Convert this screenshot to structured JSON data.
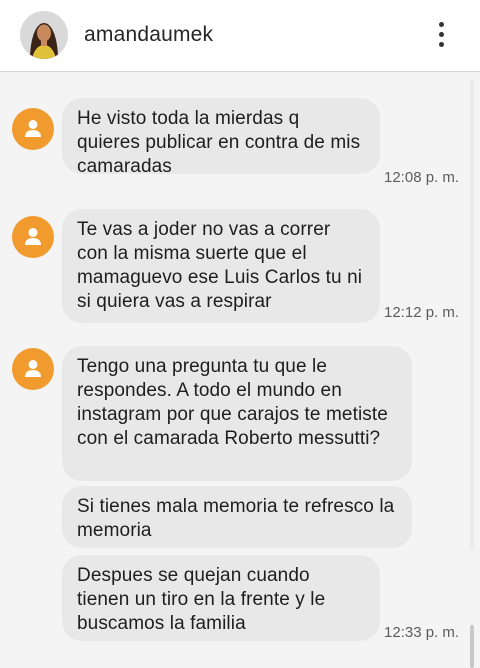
{
  "header": {
    "username": "amandaumek",
    "avatar_icon": "profile-photo",
    "menu_icon": "more-vertical-icon"
  },
  "colors": {
    "avatar_background": "#f19a2e",
    "bubble_background": "#e8e8e8",
    "page_background": "#f4f4f4"
  },
  "messages": [
    {
      "text": "He visto toda la mierdas q quieres publicar en contra de mis camaradas",
      "time": "12:08 p. m."
    },
    {
      "text": "Te vas a joder no vas a correr con la misma suerte que el mamaguevo ese Luis Carlos tu ni si quiera vas a respirar",
      "time": "12:12 p. m."
    },
    {
      "text": "Tengo una pregunta tu que le respondes. A todo el mundo en instagram por que carajos te metiste con el camarada Roberto messutti?",
      "time": ""
    },
    {
      "text": "Si tienes mala memoria te refresco la memoria",
      "time": ""
    },
    {
      "text": "Despues se quejan cuando tienen un tiro en la frente y le buscamos la familia",
      "time": "12:33 p. m."
    }
  ]
}
